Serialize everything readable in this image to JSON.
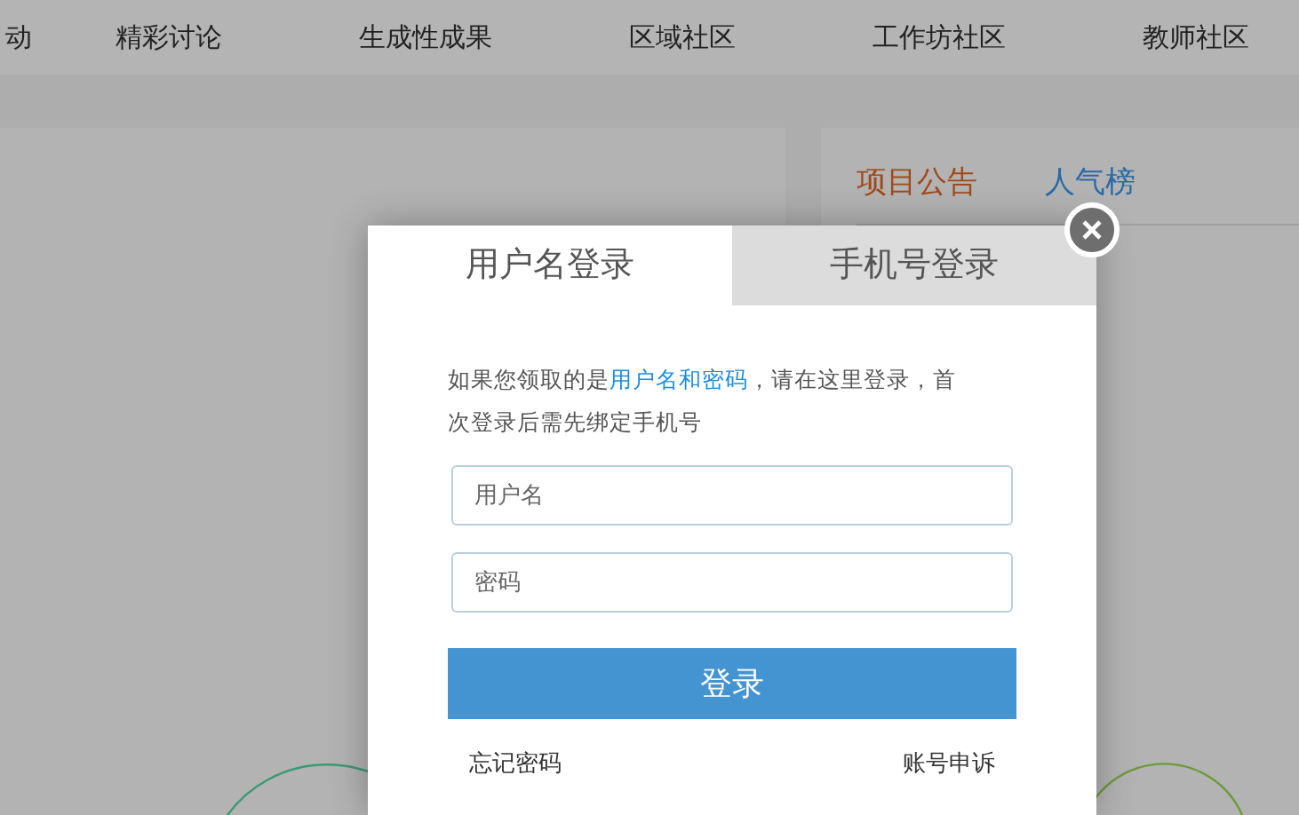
{
  "nav": {
    "items": [
      "动",
      "精彩讨论",
      "生成性成果",
      "区域社区",
      "工作坊社区",
      "教师社区"
    ]
  },
  "side_panel": {
    "tabs": [
      {
        "label": "项目公告",
        "selected": true
      },
      {
        "label": "人气榜",
        "selected": false
      }
    ]
  },
  "login_dialog": {
    "tabs": [
      {
        "label": "用户名登录",
        "selected": true
      },
      {
        "label": "手机号登录",
        "selected": false
      }
    ],
    "notice": "如果您领取的是**用户名和密码**，请在这里登录，首次登录后需先绑定手机号",
    "username": {
      "placeholder": "用户名"
    },
    "password": {
      "placeholder": "密码"
    },
    "submit": "登录",
    "links": [
      "忘记密码",
      "账号申诉"
    ]
  }
}
